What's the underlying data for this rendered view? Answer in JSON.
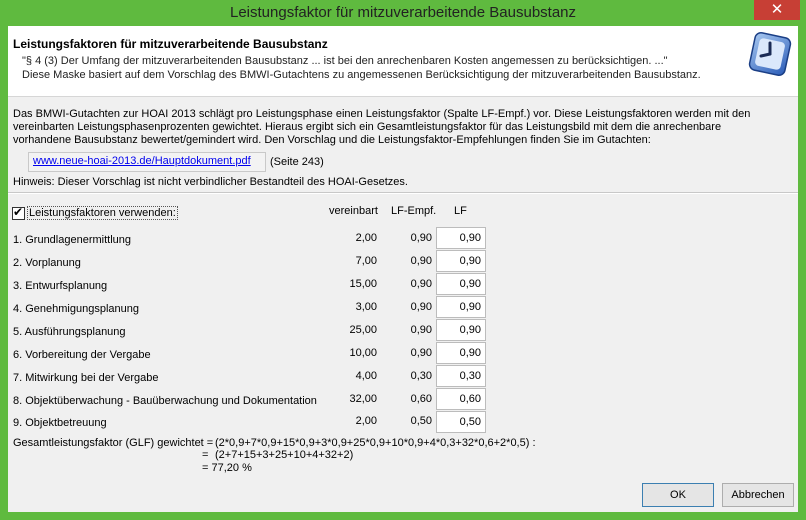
{
  "window": {
    "title": "Leistungsfaktor für mitzuverarbeitende Bausubstanz",
    "close_glyph": "✕"
  },
  "header": {
    "title": "Leistungsfaktoren für mitzuverarbeitende Bausubstanz",
    "line1": "\"§ 4 (3) Der Umfang der mitzuverarbeitenden Bausubstanz ... ist bei den anrechenbaren Kosten angemessen zu berücksichtigen. ...\"",
    "line2": "Diese Maske basiert auf dem Vorschlag des BMWI-Gutachtens zu angemessenen Berücksichtigung der mitzuverarbeitenden Bausubstanz.",
    "icon": "clock-icon"
  },
  "intro": {
    "line1": "Das BMWI-Gutachten zur HOAI 2013 schlägt pro Leistungsphase einen Leistungsfaktor (Spalte LF-Empf.) vor. Diese Leistungsfaktoren werden mit den",
    "line2": "vereinbarten Leistungsphasenprozenten gewichtet. Hieraus ergibt sich ein Gesamtleistungsfaktor für das Leistungsbild mit dem die anrechenbare",
    "line3": "vorhandene Bausubstanz bewertet/gemindert wird. Den Vorschlag und die Leistungsfaktor-Empfehlungen finden Sie im Gutachten:",
    "link": "www.neue-hoai-2013.de/Hauptdokument.pdf",
    "page_ref": "(Seite 243)",
    "note": "Hinweis: Dieser Vorschlag ist nicht verbindlicher Bestandteil  des HOAI-Gesetzes."
  },
  "checkbox": {
    "label": "Leistungsfaktoren verwenden:",
    "checked_glyph": "✔"
  },
  "columns": {
    "agreed": "vereinbart",
    "recommended": "LF-Empf.",
    "lf": "LF"
  },
  "rows": [
    {
      "label": "1. Grundlagenermittlung",
      "agreed": "2,00",
      "recommended": "0,90",
      "lf": "0,90"
    },
    {
      "label": "2. Vorplanung",
      "agreed": "7,00",
      "recommended": "0,90",
      "lf": "0,90"
    },
    {
      "label": "3. Entwurfsplanung",
      "agreed": "15,00",
      "recommended": "0,90",
      "lf": "0,90"
    },
    {
      "label": "4. Genehmigungsplanung",
      "agreed": "3,00",
      "recommended": "0,90",
      "lf": "0,90"
    },
    {
      "label": "5. Ausführungsplanung",
      "agreed": "25,00",
      "recommended": "0,90",
      "lf": "0,90"
    },
    {
      "label": "6. Vorbereitung der Vergabe",
      "agreed": "10,00",
      "recommended": "0,90",
      "lf": "0,90"
    },
    {
      "label": "7. Mitwirkung bei der Vergabe",
      "agreed": "4,00",
      "recommended": "0,30",
      "lf": "0,30"
    },
    {
      "label": "8. Objektüberwachung - Bauüberwachung und Dokumentation",
      "agreed": "32,00",
      "recommended": "0,60",
      "lf": "0,60"
    },
    {
      "label": "9. Objektbetreuung",
      "agreed": "2,00",
      "recommended": "0,50",
      "lf": "0,50"
    }
  ],
  "result": {
    "label": "Gesamtleistungsfaktor (GLF) gewichtet =",
    "numerator": "(2*0,9+7*0,9+15*0,9+3*0,9+25*0,9+10*0,9+4*0,3+32*0,6+2*0,5) :",
    "denominator": "(2+7+15+3+25+10+4+32+2)",
    "equals": "=",
    "value": "= 77,20 %"
  },
  "buttons": {
    "ok": "OK",
    "cancel": "Abbrechen"
  }
}
